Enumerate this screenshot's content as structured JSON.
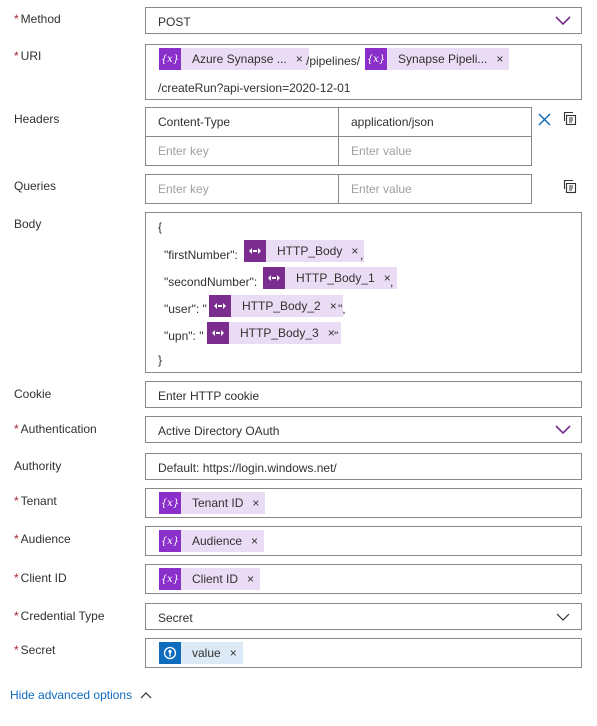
{
  "fields": {
    "method": {
      "label": "Method",
      "value": "POST"
    },
    "uri": {
      "label": "URI",
      "token1": "Azure Synapse ...",
      "mid_text": "/pipelines/",
      "token2": "Synapse Pipeli...",
      "suffix": "/createRun?api-version=2020-12-01"
    },
    "headers": {
      "label": "Headers",
      "key1": "Content-Type",
      "value1": "application/json",
      "key_placeholder": "Enter key",
      "value_placeholder": "Enter value"
    },
    "queries": {
      "label": "Queries",
      "key_placeholder": "Enter key",
      "value_placeholder": "Enter value"
    },
    "body": {
      "label": "Body",
      "open_brace": "{",
      "close_brace": "}",
      "lines": [
        {
          "key": "\"firstNumber\":",
          "token": "HTTP_Body",
          "after": ","
        },
        {
          "key": "\"secondNumber\":",
          "token": "HTTP_Body_1",
          "after": ","
        },
        {
          "key": "\"user\": \"",
          "token": "HTTP_Body_2",
          "after": "\","
        },
        {
          "key": "\"upn\": \"",
          "token": "HTTP_Body_3",
          "after": "\""
        }
      ]
    },
    "cookie": {
      "label": "Cookie",
      "placeholder": "Enter HTTP cookie"
    },
    "authentication": {
      "label": "Authentication",
      "value": "Active Directory OAuth"
    },
    "authority": {
      "label": "Authority",
      "placeholder": "Default: https://login.windows.net/"
    },
    "tenant": {
      "label": "Tenant",
      "token": "Tenant ID"
    },
    "audience": {
      "label": "Audience",
      "token": "Audience"
    },
    "client_id": {
      "label": "Client ID",
      "token": "Client ID"
    },
    "credential_type": {
      "label": "Credential Type",
      "value": "Secret"
    },
    "secret": {
      "label": "Secret",
      "token": "value"
    }
  },
  "footer": {
    "toggle_label": "Hide advanced options"
  },
  "icons": {
    "variable": "{x}",
    "remove": "×"
  },
  "colors": {
    "required": "#a4262c",
    "token_bg": "#eadcf4",
    "variable_icon": "#8a2fc9",
    "http_icon": "#7a2d8f",
    "keyvault_icon": "#0f6cbd",
    "link": "#0f6cbd"
  }
}
